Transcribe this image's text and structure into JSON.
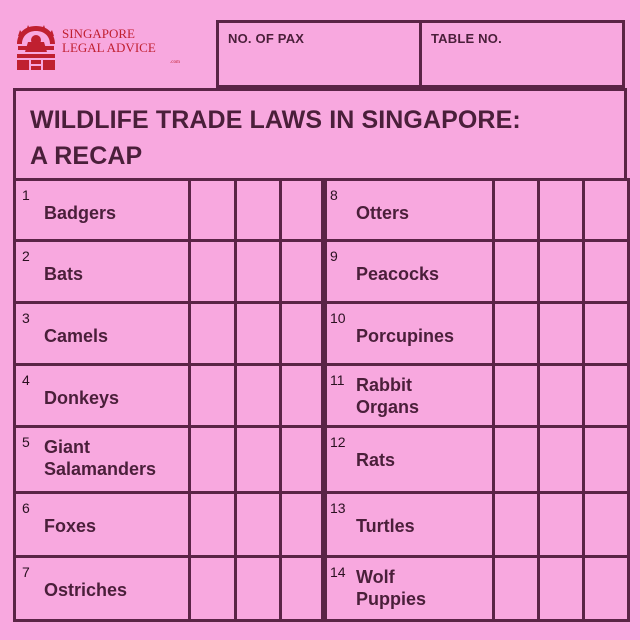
{
  "logo": {
    "line1": "SINGAPORE",
    "line2": "LEGAL ADVICE",
    "suffix": ".com",
    "primary_color": "#c02030"
  },
  "header": {
    "pax_label": "NO. OF PAX",
    "table_label": "TABLE NO."
  },
  "title": {
    "line1": "WILDLIFE TRADE LAWS IN SINGAPORE:",
    "line2": "A RECAP"
  },
  "colors": {
    "background": "#f8a8df",
    "border": "#5a2446",
    "text": "#4a1f3a"
  },
  "rows_left": [
    {
      "num": "1",
      "lines": [
        "Badgers"
      ]
    },
    {
      "num": "2",
      "lines": [
        "Bats"
      ]
    },
    {
      "num": "3",
      "lines": [
        "Camels"
      ]
    },
    {
      "num": "4",
      "lines": [
        "Donkeys"
      ]
    },
    {
      "num": "5",
      "lines": [
        "Giant",
        "Salamanders"
      ]
    },
    {
      "num": "6",
      "lines": [
        "Foxes"
      ]
    },
    {
      "num": "7",
      "lines": [
        "Ostriches"
      ]
    }
  ],
  "rows_right": [
    {
      "num": "8",
      "lines": [
        "Otters"
      ]
    },
    {
      "num": "9",
      "lines": [
        "Peacocks"
      ]
    },
    {
      "num": "10",
      "lines": [
        "Porcupines"
      ]
    },
    {
      "num": "11",
      "lines": [
        "Rabbit",
        "Organs"
      ]
    },
    {
      "num": "12",
      "lines": [
        "Rats"
      ]
    },
    {
      "num": "13",
      "lines": [
        "Turtles"
      ]
    },
    {
      "num": "14",
      "lines": [
        "Wolf",
        "Puppies"
      ]
    }
  ]
}
